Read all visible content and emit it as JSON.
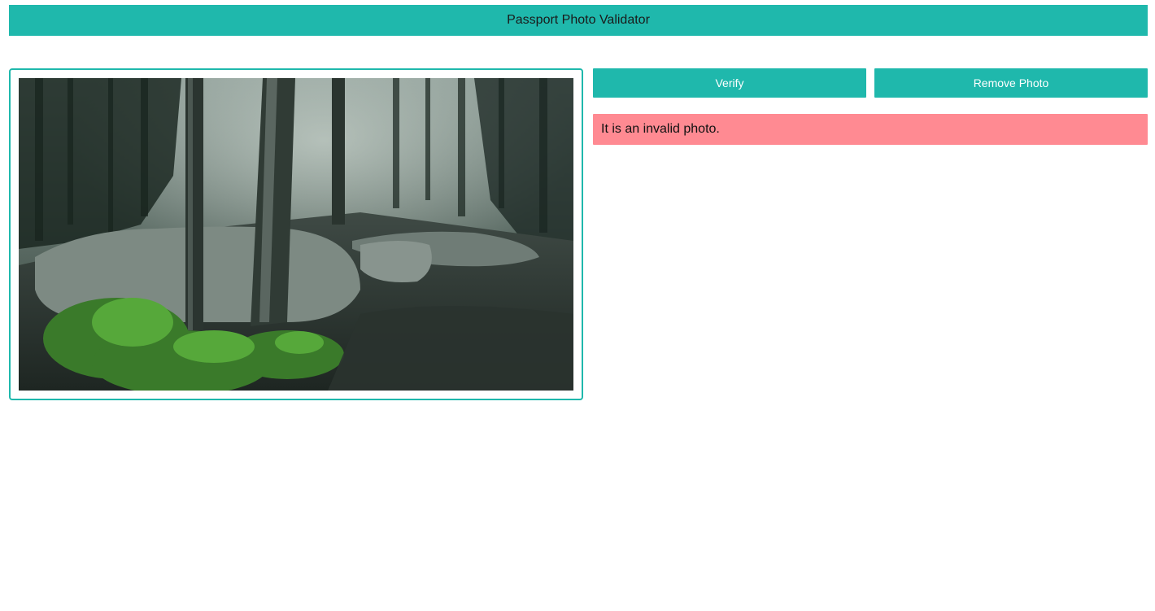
{
  "header": {
    "title": "Passport Photo Validator"
  },
  "photo": {
    "icon": "forest-photo",
    "description_icon": "uploaded-image"
  },
  "actions": {
    "verify_label": "Verify",
    "remove_label": "Remove Photo"
  },
  "result": {
    "message": "It is an invalid photo.",
    "status_color": "#ff8a92"
  },
  "colors": {
    "accent": "#1fb8ac",
    "error_bg": "#ff8a92"
  }
}
